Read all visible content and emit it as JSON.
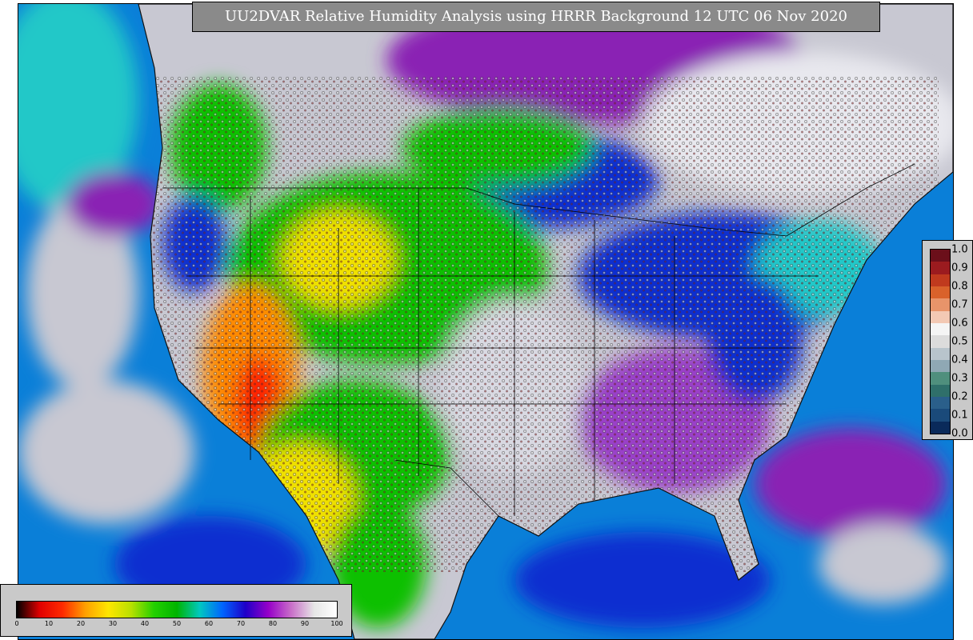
{
  "title": "UU2DVAR Relative Humidity Analysis using HRRR Background 12 UTC 06 Nov 2020",
  "colorbar_rh": {
    "ticks": [
      "0",
      "10",
      "20",
      "30",
      "40",
      "50",
      "60",
      "70",
      "80",
      "90",
      "100"
    ],
    "colors": [
      "#000000",
      "#e00000",
      "#ff2a00",
      "#ffa000",
      "#ffe600",
      "#b8e000",
      "#23d000",
      "#00b400",
      "#00c8c0",
      "#0064ff",
      "#1e00c8",
      "#9600c8",
      "#c86ec8",
      "#e6e6e6",
      "#ffffff"
    ]
  },
  "colorbar_ratio": {
    "ticks": [
      "1.0",
      "0.9",
      "0.8",
      "0.7",
      "0.6",
      "0.5",
      "0.4",
      "0.3",
      "0.2",
      "0.1",
      "0.0"
    ],
    "colors": [
      "#6b0f1a",
      "#9b1b1f",
      "#c03a1e",
      "#d9622b",
      "#e8946a",
      "#f3c9b4",
      "#f5f5f5",
      "#dcdcdc",
      "#b8c4cc",
      "#8fa8b4",
      "#4f8f7d",
      "#2f6f6a",
      "#2a5f8a",
      "#1a4a7a",
      "#0a2a5a"
    ]
  },
  "palette": {
    "ocean": "#0a7fd8",
    "ocean_dark": "#0c2fd0",
    "cloud": "#c8c8d2",
    "purple": "#8a20b4",
    "green": "#10c000",
    "yellow": "#f0e000",
    "orange": "#ff8a00",
    "red": "#ff2000",
    "cyan": "#20c8c8"
  }
}
